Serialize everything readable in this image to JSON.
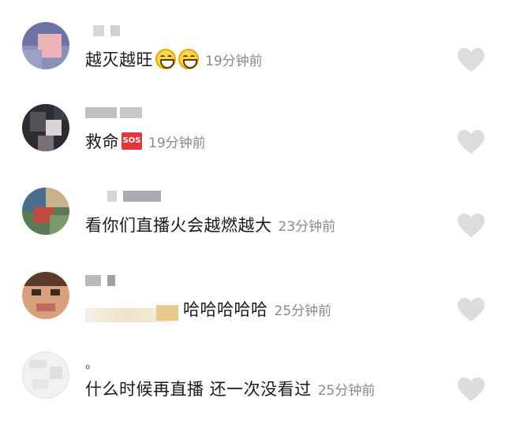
{
  "comments": [
    {
      "text": "越灭越旺",
      "emoji": [
        "grin-icon",
        "grin-icon"
      ],
      "time": "19分钟前"
    },
    {
      "text": "救命",
      "badge": "SOS",
      "time": "19分钟前"
    },
    {
      "text": "看你们直播火会越燃越大",
      "time": "23分钟前"
    },
    {
      "text": "哈哈哈哈哈",
      "time": "25分钟前"
    },
    {
      "name_fragment": "。",
      "text": "什么时候再直播 还一次没看过",
      "time": "25分钟前"
    }
  ],
  "colors": {
    "heart": "#dcdcdc",
    "time": "#8a8a8a",
    "text": "#1a1a1a",
    "sos": "#e0383a"
  }
}
